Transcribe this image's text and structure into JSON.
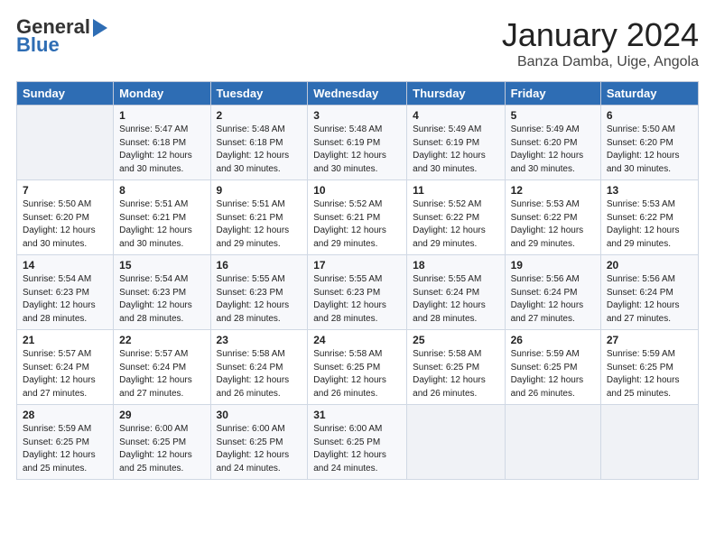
{
  "logo": {
    "line1": "General",
    "line2": "Blue",
    "arrow": true
  },
  "header": {
    "month": "January 2024",
    "location": "Banza Damba, Uige, Angola"
  },
  "columns": [
    "Sunday",
    "Monday",
    "Tuesday",
    "Wednesday",
    "Thursday",
    "Friday",
    "Saturday"
  ],
  "weeks": [
    [
      {
        "day": "",
        "info": ""
      },
      {
        "day": "1",
        "info": "Sunrise: 5:47 AM\nSunset: 6:18 PM\nDaylight: 12 hours\nand 30 minutes."
      },
      {
        "day": "2",
        "info": "Sunrise: 5:48 AM\nSunset: 6:18 PM\nDaylight: 12 hours\nand 30 minutes."
      },
      {
        "day": "3",
        "info": "Sunrise: 5:48 AM\nSunset: 6:19 PM\nDaylight: 12 hours\nand 30 minutes."
      },
      {
        "day": "4",
        "info": "Sunrise: 5:49 AM\nSunset: 6:19 PM\nDaylight: 12 hours\nand 30 minutes."
      },
      {
        "day": "5",
        "info": "Sunrise: 5:49 AM\nSunset: 6:20 PM\nDaylight: 12 hours\nand 30 minutes."
      },
      {
        "day": "6",
        "info": "Sunrise: 5:50 AM\nSunset: 6:20 PM\nDaylight: 12 hours\nand 30 minutes."
      }
    ],
    [
      {
        "day": "7",
        "info": "Sunrise: 5:50 AM\nSunset: 6:20 PM\nDaylight: 12 hours\nand 30 minutes."
      },
      {
        "day": "8",
        "info": "Sunrise: 5:51 AM\nSunset: 6:21 PM\nDaylight: 12 hours\nand 30 minutes."
      },
      {
        "day": "9",
        "info": "Sunrise: 5:51 AM\nSunset: 6:21 PM\nDaylight: 12 hours\nand 29 minutes."
      },
      {
        "day": "10",
        "info": "Sunrise: 5:52 AM\nSunset: 6:21 PM\nDaylight: 12 hours\nand 29 minutes."
      },
      {
        "day": "11",
        "info": "Sunrise: 5:52 AM\nSunset: 6:22 PM\nDaylight: 12 hours\nand 29 minutes."
      },
      {
        "day": "12",
        "info": "Sunrise: 5:53 AM\nSunset: 6:22 PM\nDaylight: 12 hours\nand 29 minutes."
      },
      {
        "day": "13",
        "info": "Sunrise: 5:53 AM\nSunset: 6:22 PM\nDaylight: 12 hours\nand 29 minutes."
      }
    ],
    [
      {
        "day": "14",
        "info": "Sunrise: 5:54 AM\nSunset: 6:23 PM\nDaylight: 12 hours\nand 28 minutes."
      },
      {
        "day": "15",
        "info": "Sunrise: 5:54 AM\nSunset: 6:23 PM\nDaylight: 12 hours\nand 28 minutes."
      },
      {
        "day": "16",
        "info": "Sunrise: 5:55 AM\nSunset: 6:23 PM\nDaylight: 12 hours\nand 28 minutes."
      },
      {
        "day": "17",
        "info": "Sunrise: 5:55 AM\nSunset: 6:23 PM\nDaylight: 12 hours\nand 28 minutes."
      },
      {
        "day": "18",
        "info": "Sunrise: 5:55 AM\nSunset: 6:24 PM\nDaylight: 12 hours\nand 28 minutes."
      },
      {
        "day": "19",
        "info": "Sunrise: 5:56 AM\nSunset: 6:24 PM\nDaylight: 12 hours\nand 27 minutes."
      },
      {
        "day": "20",
        "info": "Sunrise: 5:56 AM\nSunset: 6:24 PM\nDaylight: 12 hours\nand 27 minutes."
      }
    ],
    [
      {
        "day": "21",
        "info": "Sunrise: 5:57 AM\nSunset: 6:24 PM\nDaylight: 12 hours\nand 27 minutes."
      },
      {
        "day": "22",
        "info": "Sunrise: 5:57 AM\nSunset: 6:24 PM\nDaylight: 12 hours\nand 27 minutes."
      },
      {
        "day": "23",
        "info": "Sunrise: 5:58 AM\nSunset: 6:24 PM\nDaylight: 12 hours\nand 26 minutes."
      },
      {
        "day": "24",
        "info": "Sunrise: 5:58 AM\nSunset: 6:25 PM\nDaylight: 12 hours\nand 26 minutes."
      },
      {
        "day": "25",
        "info": "Sunrise: 5:58 AM\nSunset: 6:25 PM\nDaylight: 12 hours\nand 26 minutes."
      },
      {
        "day": "26",
        "info": "Sunrise: 5:59 AM\nSunset: 6:25 PM\nDaylight: 12 hours\nand 26 minutes."
      },
      {
        "day": "27",
        "info": "Sunrise: 5:59 AM\nSunset: 6:25 PM\nDaylight: 12 hours\nand 25 minutes."
      }
    ],
    [
      {
        "day": "28",
        "info": "Sunrise: 5:59 AM\nSunset: 6:25 PM\nDaylight: 12 hours\nand 25 minutes."
      },
      {
        "day": "29",
        "info": "Sunrise: 6:00 AM\nSunset: 6:25 PM\nDaylight: 12 hours\nand 25 minutes."
      },
      {
        "day": "30",
        "info": "Sunrise: 6:00 AM\nSunset: 6:25 PM\nDaylight: 12 hours\nand 24 minutes."
      },
      {
        "day": "31",
        "info": "Sunrise: 6:00 AM\nSunset: 6:25 PM\nDaylight: 12 hours\nand 24 minutes."
      },
      {
        "day": "",
        "info": ""
      },
      {
        "day": "",
        "info": ""
      },
      {
        "day": "",
        "info": ""
      }
    ]
  ]
}
